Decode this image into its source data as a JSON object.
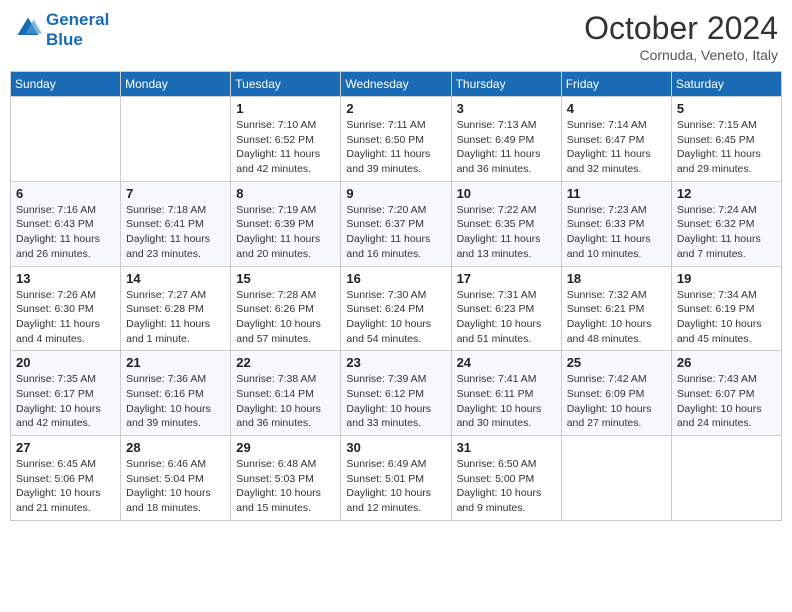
{
  "header": {
    "logo_line1": "General",
    "logo_line2": "Blue",
    "month": "October 2024",
    "location": "Cornuda, Veneto, Italy"
  },
  "weekdays": [
    "Sunday",
    "Monday",
    "Tuesday",
    "Wednesday",
    "Thursday",
    "Friday",
    "Saturday"
  ],
  "weeks": [
    [
      {
        "day": "",
        "info": ""
      },
      {
        "day": "",
        "info": ""
      },
      {
        "day": "1",
        "info": "Sunrise: 7:10 AM\nSunset: 6:52 PM\nDaylight: 11 hours and 42 minutes."
      },
      {
        "day": "2",
        "info": "Sunrise: 7:11 AM\nSunset: 6:50 PM\nDaylight: 11 hours and 39 minutes."
      },
      {
        "day": "3",
        "info": "Sunrise: 7:13 AM\nSunset: 6:49 PM\nDaylight: 11 hours and 36 minutes."
      },
      {
        "day": "4",
        "info": "Sunrise: 7:14 AM\nSunset: 6:47 PM\nDaylight: 11 hours and 32 minutes."
      },
      {
        "day": "5",
        "info": "Sunrise: 7:15 AM\nSunset: 6:45 PM\nDaylight: 11 hours and 29 minutes."
      }
    ],
    [
      {
        "day": "6",
        "info": "Sunrise: 7:16 AM\nSunset: 6:43 PM\nDaylight: 11 hours and 26 minutes."
      },
      {
        "day": "7",
        "info": "Sunrise: 7:18 AM\nSunset: 6:41 PM\nDaylight: 11 hours and 23 minutes."
      },
      {
        "day": "8",
        "info": "Sunrise: 7:19 AM\nSunset: 6:39 PM\nDaylight: 11 hours and 20 minutes."
      },
      {
        "day": "9",
        "info": "Sunrise: 7:20 AM\nSunset: 6:37 PM\nDaylight: 11 hours and 16 minutes."
      },
      {
        "day": "10",
        "info": "Sunrise: 7:22 AM\nSunset: 6:35 PM\nDaylight: 11 hours and 13 minutes."
      },
      {
        "day": "11",
        "info": "Sunrise: 7:23 AM\nSunset: 6:33 PM\nDaylight: 11 hours and 10 minutes."
      },
      {
        "day": "12",
        "info": "Sunrise: 7:24 AM\nSunset: 6:32 PM\nDaylight: 11 hours and 7 minutes."
      }
    ],
    [
      {
        "day": "13",
        "info": "Sunrise: 7:26 AM\nSunset: 6:30 PM\nDaylight: 11 hours and 4 minutes."
      },
      {
        "day": "14",
        "info": "Sunrise: 7:27 AM\nSunset: 6:28 PM\nDaylight: 11 hours and 1 minute."
      },
      {
        "day": "15",
        "info": "Sunrise: 7:28 AM\nSunset: 6:26 PM\nDaylight: 10 hours and 57 minutes."
      },
      {
        "day": "16",
        "info": "Sunrise: 7:30 AM\nSunset: 6:24 PM\nDaylight: 10 hours and 54 minutes."
      },
      {
        "day": "17",
        "info": "Sunrise: 7:31 AM\nSunset: 6:23 PM\nDaylight: 10 hours and 51 minutes."
      },
      {
        "day": "18",
        "info": "Sunrise: 7:32 AM\nSunset: 6:21 PM\nDaylight: 10 hours and 48 minutes."
      },
      {
        "day": "19",
        "info": "Sunrise: 7:34 AM\nSunset: 6:19 PM\nDaylight: 10 hours and 45 minutes."
      }
    ],
    [
      {
        "day": "20",
        "info": "Sunrise: 7:35 AM\nSunset: 6:17 PM\nDaylight: 10 hours and 42 minutes."
      },
      {
        "day": "21",
        "info": "Sunrise: 7:36 AM\nSunset: 6:16 PM\nDaylight: 10 hours and 39 minutes."
      },
      {
        "day": "22",
        "info": "Sunrise: 7:38 AM\nSunset: 6:14 PM\nDaylight: 10 hours and 36 minutes."
      },
      {
        "day": "23",
        "info": "Sunrise: 7:39 AM\nSunset: 6:12 PM\nDaylight: 10 hours and 33 minutes."
      },
      {
        "day": "24",
        "info": "Sunrise: 7:41 AM\nSunset: 6:11 PM\nDaylight: 10 hours and 30 minutes."
      },
      {
        "day": "25",
        "info": "Sunrise: 7:42 AM\nSunset: 6:09 PM\nDaylight: 10 hours and 27 minutes."
      },
      {
        "day": "26",
        "info": "Sunrise: 7:43 AM\nSunset: 6:07 PM\nDaylight: 10 hours and 24 minutes."
      }
    ],
    [
      {
        "day": "27",
        "info": "Sunrise: 6:45 AM\nSunset: 5:06 PM\nDaylight: 10 hours and 21 minutes."
      },
      {
        "day": "28",
        "info": "Sunrise: 6:46 AM\nSunset: 5:04 PM\nDaylight: 10 hours and 18 minutes."
      },
      {
        "day": "29",
        "info": "Sunrise: 6:48 AM\nSunset: 5:03 PM\nDaylight: 10 hours and 15 minutes."
      },
      {
        "day": "30",
        "info": "Sunrise: 6:49 AM\nSunset: 5:01 PM\nDaylight: 10 hours and 12 minutes."
      },
      {
        "day": "31",
        "info": "Sunrise: 6:50 AM\nSunset: 5:00 PM\nDaylight: 10 hours and 9 minutes."
      },
      {
        "day": "",
        "info": ""
      },
      {
        "day": "",
        "info": ""
      }
    ]
  ]
}
